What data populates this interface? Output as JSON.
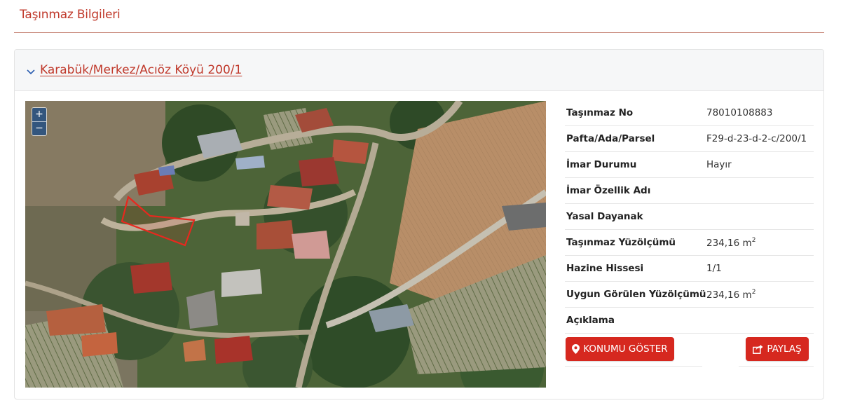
{
  "page": {
    "title": "Taşınmaz Bilgileri"
  },
  "property": {
    "header_link": "Karabük/Merkez/Acıöz Köyü 200/1",
    "rows": [
      {
        "label": "Taşınmaz No",
        "value": "78010108883"
      },
      {
        "label": "Pafta/Ada/Parsel",
        "value": "F29-d-23-d-2-c/200/1"
      },
      {
        "label": "İmar Durumu",
        "value": "Hayır"
      },
      {
        "label": "İmar Özellik Adı",
        "value": ""
      },
      {
        "label": "Yasal Dayanak",
        "value": ""
      },
      {
        "label": "Taşınmaz Yüzölçümü",
        "value": "234,16 m",
        "unit_sup": "2"
      },
      {
        "label": "Hazine Hissesi",
        "value": "1/1"
      },
      {
        "label": "Uygun Görülen Yüzölçümü",
        "value": "234,16 m",
        "unit_sup": "2"
      },
      {
        "label": "Açıklama",
        "value": ""
      }
    ]
  },
  "map": {
    "zoom_in": "+",
    "zoom_out": "−",
    "parcel_outline_color": "#e8281e"
  },
  "actions": {
    "show_location": "KONUMU GÖSTER",
    "share": "PAYLAŞ"
  },
  "icons": {
    "header": "chevron-down-icon",
    "show_location": "map-marker-icon",
    "share": "share-icon"
  },
  "colors": {
    "accent": "#c0392b",
    "button": "#d6281f",
    "zoom_control": "#2a5282"
  }
}
